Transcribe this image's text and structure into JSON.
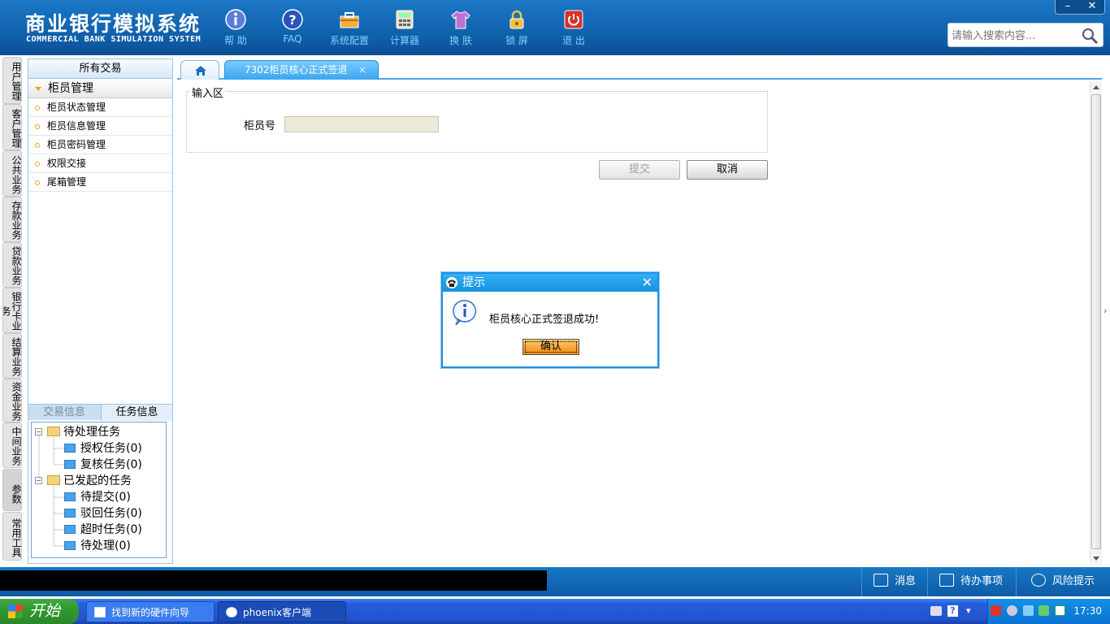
{
  "header": {
    "title_cn": "商业银行模拟系统",
    "title_en": "COMMERCIAL BANK SIMULATION SYSTEM",
    "toolbar": [
      {
        "label": "帮 助",
        "icon": "info-icon"
      },
      {
        "label": "FAQ",
        "icon": "question-icon"
      },
      {
        "label": "系统配置",
        "icon": "toolbox-icon"
      },
      {
        "label": "计算器",
        "icon": "calculator-icon"
      },
      {
        "label": "换 肤",
        "icon": "shirt-icon"
      },
      {
        "label": "锁 屏",
        "icon": "lock-icon"
      },
      {
        "label": "退 出",
        "icon": "power-icon"
      }
    ],
    "window_controls": {
      "minimize": "–",
      "close": "✕"
    },
    "search": {
      "placeholder": "请输入搜索内容..."
    }
  },
  "vertical_tabs": [
    "用户管理",
    "客户管理",
    "公共业务",
    "存款业务",
    "贷款业务",
    "银行卡业务",
    "结算业务",
    "资金业务",
    "中间业务",
    "参数",
    "常用工具"
  ],
  "left_panel": {
    "header": "所有交易",
    "group": "柜员管理",
    "items": [
      "柜员状态管理",
      "柜员信息管理",
      "柜员密码管理",
      "权限交接",
      "尾箱管理"
    ],
    "tabs": [
      "交易信息",
      "任务信息"
    ],
    "tree": {
      "pending": {
        "label": "待处理任务",
        "children": [
          "授权任务(0)",
          "复核任务(0)"
        ]
      },
      "initiated": {
        "label": "已发起的任务",
        "children": [
          "待提交(0)",
          "驳回任务(0)",
          "超时任务(0)",
          "待处理(0)"
        ]
      }
    }
  },
  "tabs": {
    "active_tab": "7302柜员核心正式签退",
    "close": "×"
  },
  "form": {
    "section_title": "输入区",
    "teller_label": "柜员号",
    "teller_value": "",
    "submit_label": "提交",
    "cancel_label": "取消"
  },
  "dialog": {
    "title": "提示",
    "message": "柜员核心正式签退成功!",
    "ok_label": "确认",
    "close": "✕"
  },
  "status_bar": {
    "items": [
      "消息",
      "待办事项",
      "风险提示"
    ]
  },
  "taskbar": {
    "start": "开始",
    "tasks": [
      "找到新的硬件向导",
      "phoenix客户端"
    ],
    "clock": "17:30"
  },
  "colors": {
    "header": "#1070bb",
    "accent": "#1e90e0",
    "dialog_button": "#f5a030"
  }
}
